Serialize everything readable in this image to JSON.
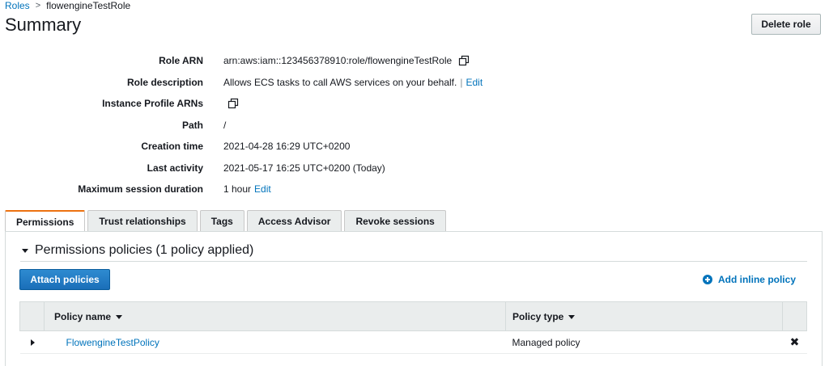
{
  "breadcrumb": {
    "parent": "Roles",
    "separator": ">",
    "current": "flowengineTestRole"
  },
  "page": {
    "title": "Summary",
    "delete_label": "Delete role"
  },
  "summary": {
    "role_arn": {
      "label": "Role ARN",
      "value": "arn:aws:iam::123456378910:role/flowengineTestRole"
    },
    "role_description": {
      "label": "Role description",
      "value": "Allows ECS tasks to call AWS services on your behalf.",
      "pipe": "|",
      "edit": "Edit"
    },
    "instance_profile_arns": {
      "label": "Instance Profile ARNs"
    },
    "path": {
      "label": "Path",
      "value": "/"
    },
    "creation_time": {
      "label": "Creation time",
      "value": "2021-04-28 16:29 UTC+0200"
    },
    "last_activity": {
      "label": "Last activity",
      "value": "2021-05-17 16:25 UTC+0200 (Today)"
    },
    "max_session_duration": {
      "label": "Maximum session duration",
      "value": "1 hour",
      "edit": "Edit"
    }
  },
  "tabs": [
    {
      "label": "Permissions",
      "active": true
    },
    {
      "label": "Trust relationships",
      "active": false
    },
    {
      "label": "Tags",
      "active": false
    },
    {
      "label": "Access Advisor",
      "active": false
    },
    {
      "label": "Revoke sessions",
      "active": false
    }
  ],
  "permissions": {
    "section_title": "Permissions policies (1 policy applied)",
    "attach_label": "Attach policies",
    "add_inline_label": "Add inline policy",
    "columns": {
      "name": "Policy name",
      "type": "Policy type"
    },
    "rows": [
      {
        "name": "FlowengineTestPolicy",
        "type": "Managed policy"
      }
    ]
  },
  "icons": {
    "copy": "copy-icon",
    "remove": "close-icon",
    "add": "plus-circle-icon"
  }
}
